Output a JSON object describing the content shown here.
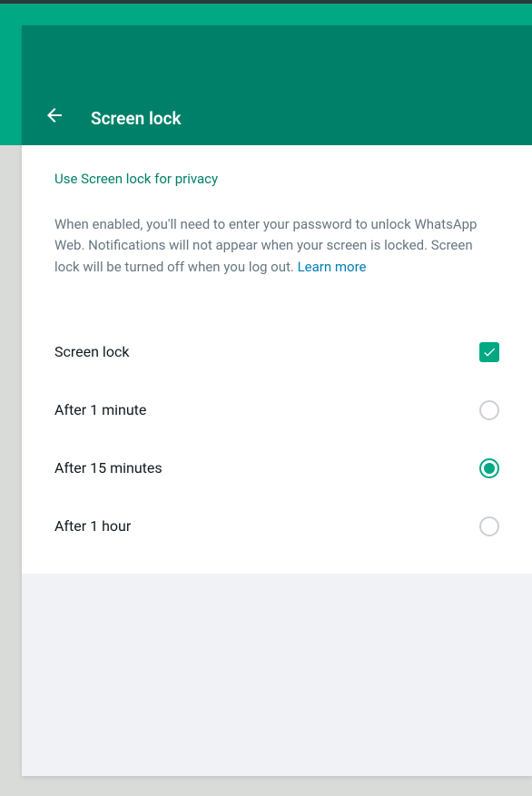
{
  "header": {
    "title": "Screen lock"
  },
  "section": {
    "title": "Use Screen lock for privacy",
    "description": "When enabled, you'll need to enter your password to unlock WhatsApp Web. Notifications will not appear when your screen is locked. Screen lock will be turned off when you log out. ",
    "learn_more": "Learn more"
  },
  "toggle": {
    "label": "Screen lock",
    "checked": true
  },
  "options": [
    {
      "label": "After 1 minute",
      "selected": false
    },
    {
      "label": "After 15 minutes",
      "selected": true
    },
    {
      "label": "After 1 hour",
      "selected": false
    }
  ]
}
